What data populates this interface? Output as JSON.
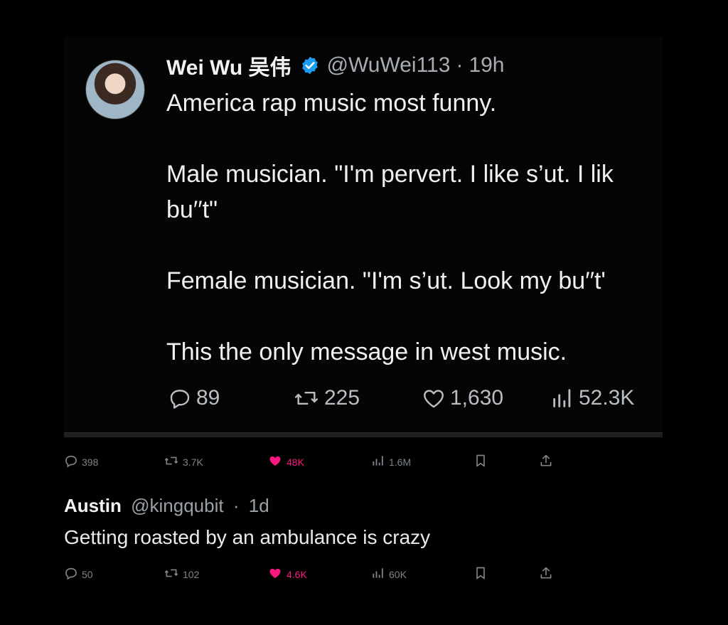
{
  "tweet": {
    "display_name": "Wei Wu 吴伟",
    "handle": "@WuWei113",
    "separator": "·",
    "time": "19h",
    "lines": [
      "America rap music most funny.",
      "",
      "Male musician. \"I'm pervert. I like s’ut. I lik",
      "bu′′t\"",
      "",
      "Female musician. \"I'm s’ut. Look my bu′′t'",
      "",
      "This the only message in west music."
    ],
    "metrics": {
      "replies": "89",
      "retweets": "225",
      "likes": "1,630",
      "views": "52.3K"
    }
  },
  "quote_actions": {
    "replies": "398",
    "retweets": "3.7K",
    "likes": "48K",
    "views": "1.6M"
  },
  "reply": {
    "display_name": "Austin",
    "handle": "@kingqubit",
    "separator": "·",
    "time": "1d",
    "text": "Getting roasted by an ambulance is crazy",
    "metrics": {
      "replies": "50",
      "retweets": "102",
      "likes": "4.6K",
      "views": "60K"
    }
  },
  "colors": {
    "background": "#000000",
    "verified_badge": "#1d9bf0",
    "like_active": "#f91880",
    "secondary_text": "#a7adb3"
  },
  "icons": [
    "reply-icon",
    "retweet-icon",
    "like-icon",
    "views-icon",
    "bookmark-icon",
    "share-icon",
    "verified-icon"
  ]
}
